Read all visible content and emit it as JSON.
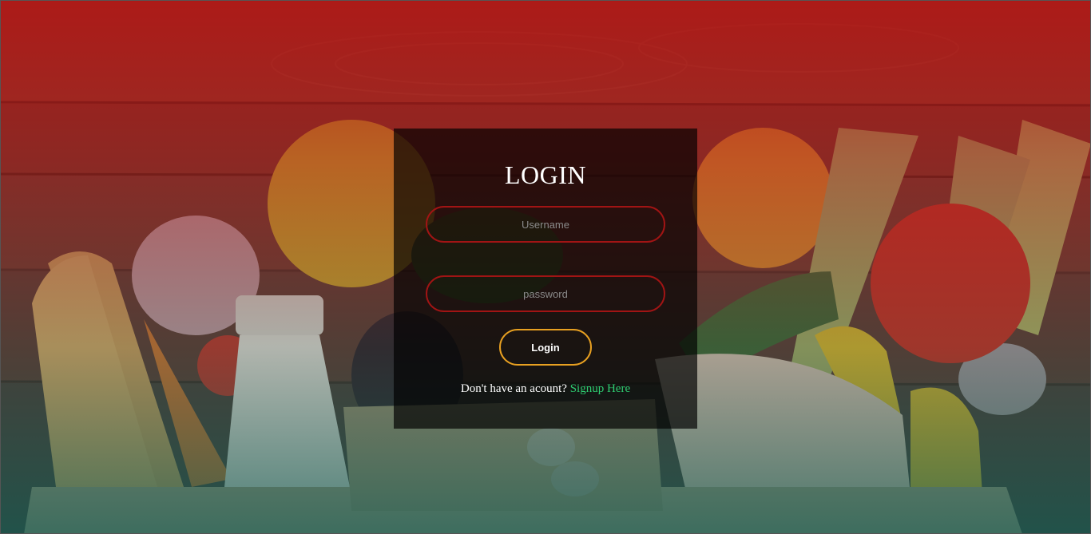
{
  "login": {
    "title": "LOGIN",
    "username_placeholder": "Username",
    "password_placeholder": "password",
    "button_label": "Login",
    "signup_prompt": "Don't have an acount?",
    "signup_link": "Signup Here"
  },
  "colors": {
    "input_border": "#a11414",
    "button_border": "#e8a021",
    "link": "#2ecc71",
    "overlay_top": "#b21414",
    "overlay_bottom": "#145a50"
  }
}
